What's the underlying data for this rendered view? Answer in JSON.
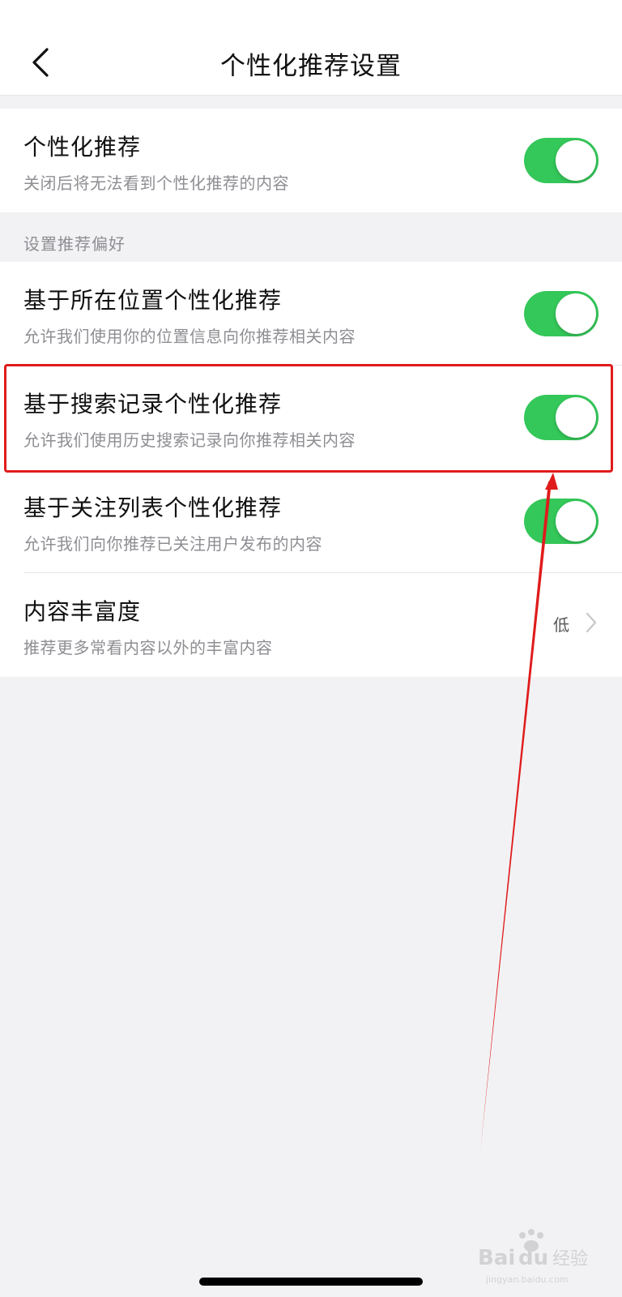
{
  "nav": {
    "title": "个性化推荐设置"
  },
  "main_setting": {
    "title": "个性化推荐",
    "description": "关闭后将无法看到个性化推荐的内容",
    "enabled": true
  },
  "section": {
    "header": "设置推荐偏好"
  },
  "preferences": [
    {
      "title": "基于所在位置个性化推荐",
      "description": "允许我们使用你的位置信息向你推荐相关内容",
      "enabled": true
    },
    {
      "title": "基于搜索记录个性化推荐",
      "description": "允许我们使用历史搜索记录向你推荐相关内容",
      "enabled": true
    },
    {
      "title": "基于关注列表个性化推荐",
      "description": "允许我们向你推荐已关注用户发布的内容",
      "enabled": true
    }
  ],
  "richness": {
    "title": "内容丰富度",
    "description": "推荐更多常看内容以外的丰富内容",
    "value": "低"
  },
  "icons": {
    "back": "chevron-left-icon",
    "disclosure": "chevron-right-icon"
  },
  "colors": {
    "toggle_on": "#34c759",
    "annotation": "#e01b1b",
    "background": "#f2f2f4"
  },
  "watermark": {
    "brand": "Baidu经验",
    "url": "jingyan.baidu.com"
  }
}
